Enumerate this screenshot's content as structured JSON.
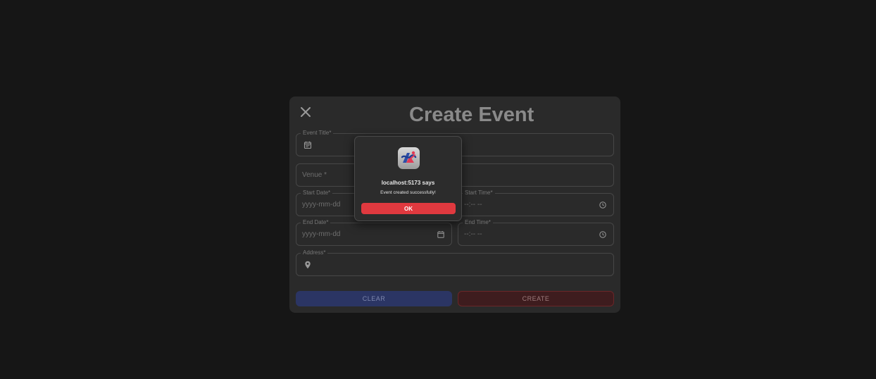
{
  "modal": {
    "title": "Create Event",
    "close_icon": "close-icon"
  },
  "form": {
    "event_title": {
      "label": "Event Title",
      "required_mark": "*",
      "value": "",
      "icon": "calendar-event-icon"
    },
    "venue": {
      "placeholder": "Venue",
      "required_mark": "*",
      "value": ""
    },
    "start_date": {
      "label": "Start Date",
      "required_mark": "*",
      "value": "yyyy-mm-dd"
    },
    "start_time": {
      "label": "Start Time",
      "required_mark": "*",
      "value": "--:-- --",
      "icon": "clock-icon"
    },
    "end_date": {
      "label": "End Date",
      "required_mark": "*",
      "value": "yyyy-mm-dd",
      "icon": "calendar-icon"
    },
    "end_time": {
      "label": "End Time",
      "required_mark": "*",
      "value": "--:-- --",
      "icon": "clock-icon"
    },
    "address": {
      "label": "Address",
      "required_mark": "*",
      "value": "",
      "icon": "location-pin-icon"
    }
  },
  "buttons": {
    "clear": "CLEAR",
    "create": "CREATE"
  },
  "alert": {
    "icon": "app-logo-icon",
    "title": "localhost:5173 says",
    "message": "Event created successfully!",
    "ok_label": "OK"
  },
  "colors": {
    "background": "#161616",
    "modal": "#2a2a2a",
    "clear_button": "#2b3564",
    "create_button": "#3e1c1e",
    "ok_button": "#e0393f"
  }
}
